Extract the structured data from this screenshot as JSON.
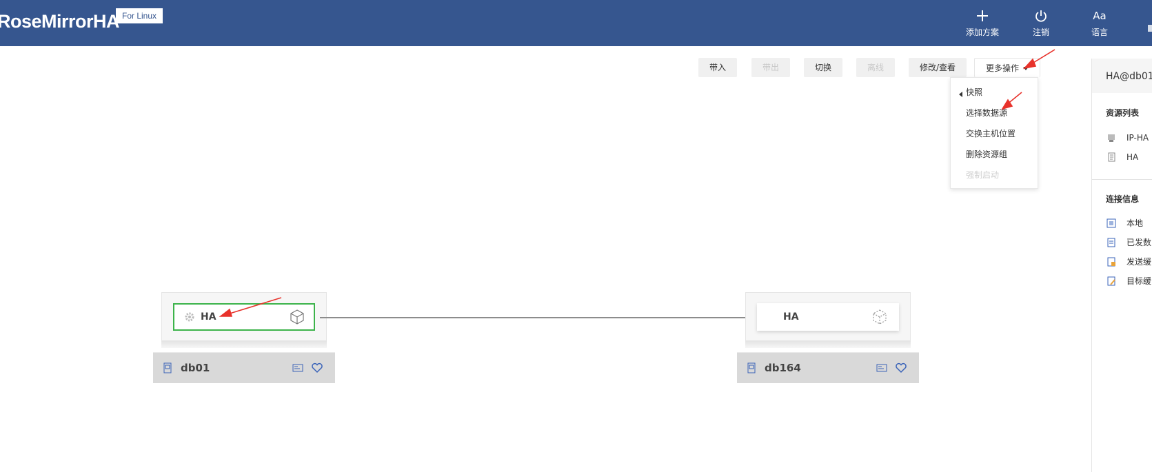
{
  "header": {
    "brand": "RoseMirrorHA",
    "badge": "For Linux",
    "actions": [
      {
        "label": "添加方案",
        "icon": "plus-icon"
      },
      {
        "label": "注销",
        "icon": "power-icon"
      },
      {
        "label": "语言",
        "icon": "text-icon",
        "glyph": "Aa"
      }
    ]
  },
  "toolbar": {
    "import": "带入",
    "export": "带出",
    "switch": "切换",
    "offline": "离线",
    "modify": "修改/查看",
    "more": "更多操作"
  },
  "dropdown": {
    "items": [
      "快照",
      "选择数据源",
      "交换主机位置",
      "删除资源组",
      "强制启动"
    ]
  },
  "right_panel": {
    "title": "HA@db01",
    "resource_list_title": "资源列表",
    "resources": [
      "IP-HA",
      "HA"
    ],
    "connection_title": "连接信息",
    "connection_items": [
      "本地",
      "已发数",
      "发送缓",
      "目标缓"
    ]
  },
  "nodes": [
    {
      "resource": "HA",
      "host": "db01",
      "selected": true
    },
    {
      "resource": "HA",
      "host": "db164",
      "selected": false
    }
  ],
  "colors": {
    "header_bg": "#36568f",
    "selected_border": "#3cb34a",
    "annotation_arrow": "#e8322b",
    "icon_blue": "#3a63b8"
  }
}
